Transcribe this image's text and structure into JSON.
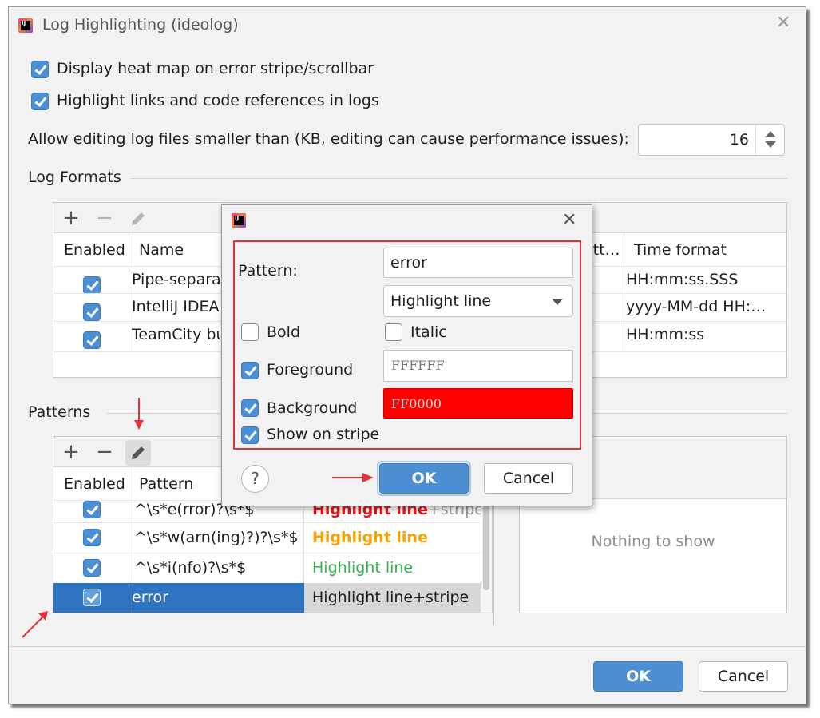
{
  "window": {
    "title": "Log Highlighting (ideolog)"
  },
  "options": {
    "heat_map": {
      "label": "Display heat map on error stripe/scrollbar",
      "checked": true
    },
    "links": {
      "label": "Highlight links and code references in logs",
      "checked": true
    },
    "edit_limit": {
      "label": "Allow editing log files smaller than (KB, editing can cause performance issues):",
      "value": "16"
    }
  },
  "log_formats": {
    "title": "Log Formats",
    "columns": [
      "Enabled",
      "Name",
      "att…",
      "Time format"
    ],
    "rows": [
      {
        "enabled": true,
        "name": "Pipe-separa",
        "time_format": "HH:mm:ss.SSS"
      },
      {
        "enabled": true,
        "name": "IntelliJ IDEA",
        "time_format": "yyyy-MM-dd HH:…"
      },
      {
        "enabled": true,
        "name": "TeamCity bu",
        "time_format": "HH:mm:ss"
      }
    ]
  },
  "patterns": {
    "title": "Patterns",
    "columns": [
      "Enabled",
      "Pattern"
    ],
    "rows": [
      {
        "enabled": true,
        "pattern": "^\\s*e(rror)?\\s*$",
        "action": "Highlight line",
        "action_suffix": "+stripe",
        "color": "#e8171b",
        "selected": false
      },
      {
        "enabled": true,
        "pattern": "^\\s*w(arn(ing)?)?\\s*$",
        "action": "Highlight line",
        "action_suffix": "",
        "color": "#f5a300",
        "selected": false
      },
      {
        "enabled": true,
        "pattern": "^\\s*i(nfo)?\\s*$",
        "action": "Highlight line",
        "action_suffix": "",
        "color": "#34b34a",
        "selected": false
      },
      {
        "enabled": true,
        "pattern": "error",
        "action": "Highlight line",
        "action_suffix": "+stripe",
        "color": "#1f1f1f",
        "selected": true
      }
    ],
    "empty_text": "Nothing to show"
  },
  "popup": {
    "pattern_label": "Pattern:",
    "pattern_value": "error",
    "action_value": "Highlight line",
    "bold": {
      "label": "Bold",
      "checked": false
    },
    "italic": {
      "label": "Italic",
      "checked": false
    },
    "foreground": {
      "label": "Foreground",
      "checked": true,
      "value": "FFFFFF"
    },
    "background": {
      "label": "Background",
      "checked": true,
      "value": "FF0000",
      "color": "#ff0000"
    },
    "stripe": {
      "label": "Show on stripe",
      "checked": true
    },
    "help": "?",
    "ok": "OK",
    "cancel": "Cancel"
  },
  "footer": {
    "ok": "OK",
    "cancel": "Cancel"
  },
  "toolbar_icons": {
    "add": "+",
    "remove": "−"
  },
  "colors": {
    "accent": "#4e8ed3",
    "selection": "#2f74c0",
    "annotation": "#e2333d"
  }
}
